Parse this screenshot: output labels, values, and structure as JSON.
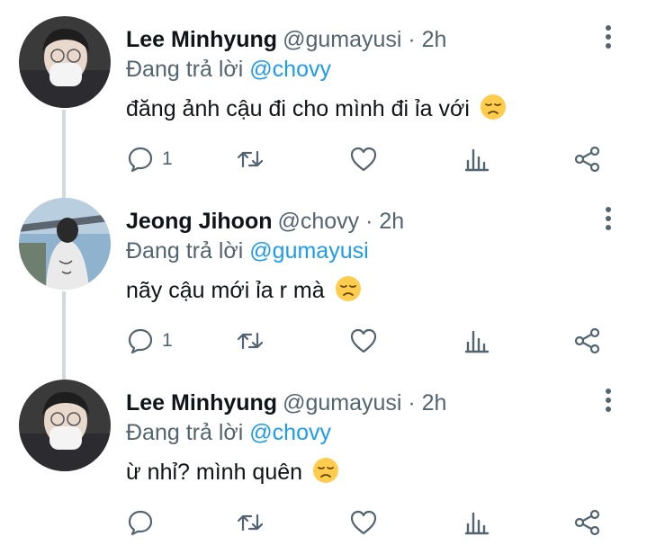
{
  "tweets": [
    {
      "name": "Lee Minhyung",
      "handle": "@gumayusi · 2h",
      "reply_prefix": "Đang trả lời",
      "reply_to": "@chovy",
      "text": "đăng ảnh cậu đi cho mình đi ỉa với",
      "emoji": "disappointed-face",
      "reply_count": "1"
    },
    {
      "name": "Jeong Jihoon",
      "handle": "@chovy · 2h",
      "reply_prefix": "Đang trả lời",
      "reply_to": "@gumayusi",
      "text": "nãy cậu mới ỉa r mà",
      "emoji": "disappointed-face",
      "reply_count": "1"
    },
    {
      "name": "Lee Minhyung",
      "handle": "@gumayusi · 2h",
      "reply_prefix": "Đang trả lời",
      "reply_to": "@chovy",
      "text": "ừ nhỉ? mình quên",
      "emoji": "disappointed-face",
      "reply_count": ""
    }
  ],
  "colors": {
    "mention": "#1d9bf0",
    "secondary_text": "#536471",
    "thread_line": "#cfd9de"
  }
}
